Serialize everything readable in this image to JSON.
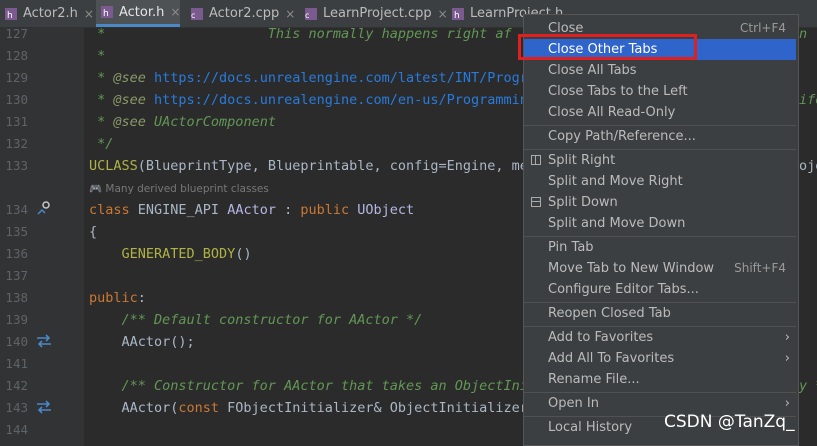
{
  "tabs": [
    {
      "label": "Actor2.h"
    },
    {
      "label": "Actor.h"
    },
    {
      "label": "Actor2.cpp"
    },
    {
      "label": "LearnProject.cpp"
    },
    {
      "label": "LearnProject.h"
    }
  ],
  "close_glyph": "×",
  "lines": {
    "n127": "127",
    "n128": "128",
    "n129": "129",
    "n130": "130",
    "n131": "131",
    "n132": "132",
    "n133": "133",
    "n134": "134",
    "n135": "135",
    "n136": "136",
    "n137": "137",
    "n138": "138",
    "n139": "139",
    "n140": "140",
    "n141": "141",
    "n142": "142",
    "n143": "143",
    "n144": "144"
  },
  "code": {
    "l127": " *                    This normally happens right af",
    "l128": " *",
    "l129_pre": " * ",
    "l129_tag": "@see",
    "l129_link": " https://docs.unrealengine.com/latest/INT/Progr",
    "l130_pre": " * ",
    "l130_tag": "@see",
    "l130_link": " https://docs.unrealengine.com/en-us/Programmin",
    "l131_pre": " * ",
    "l131_tag": "@see",
    "l131_rest": " UActorComponent",
    "l132": " */",
    "l133_macro": "UCLASS",
    "l133_rest": "(BlueprintType, Blueprintable, config=Engine, me",
    "hint": "Many derived blueprint classes",
    "l134_kw": "class",
    "l134_mid": " ENGINE_API ",
    "l134_cls": "AActor",
    "l134_colon": " : ",
    "l134_pub": "public",
    "l134_base": " UObject",
    "l135": "{",
    "l136_macro": "    GENERATED_BODY",
    "l136_rest": "()",
    "l138_kw": "public",
    "l138_rest": ":",
    "l139": "    /** Default constructor for AActor */",
    "l140": "    AActor();",
    "l142": "    /** Constructor for AActor that takes an ObjectIni",
    "l143_a": "    AActor(",
    "l143_kw": "const",
    "l143_b": " FObjectInitializer& ObjectInitializer",
    "r127": "n",
    "r130": "ife",
    "r133": "oje",
    "r142": "y *"
  },
  "menu": {
    "close": "Close",
    "close_sc": "Ctrl+F4",
    "close_other": "Close Other Tabs",
    "close_all": "Close All Tabs",
    "close_left": "Close Tabs to the Left",
    "close_readonly": "Close All Read-Only",
    "copy_path": "Copy Path/Reference...",
    "split_right": "Split Right",
    "split_move_right": "Split and Move Right",
    "split_down": "Split Down",
    "split_move_down": "Split and Move Down",
    "pin_tab": "Pin Tab",
    "move_window": "Move Tab to New Window",
    "move_window_sc": "Shift+F4",
    "configure": "Configure Editor Tabs...",
    "reopen": "Reopen Closed Tab",
    "add_fav": "Add to Favorites",
    "add_all_fav": "Add All To Favorites",
    "rename": "Rename File...",
    "open_in": "Open In",
    "local_history": "Local History"
  },
  "watermark": "CSDN @TanZq_",
  "colors": {
    "accent": "#2f65ca",
    "highlight_box": "#e02020",
    "comment": "#629755",
    "keyword": "#cc7832"
  }
}
